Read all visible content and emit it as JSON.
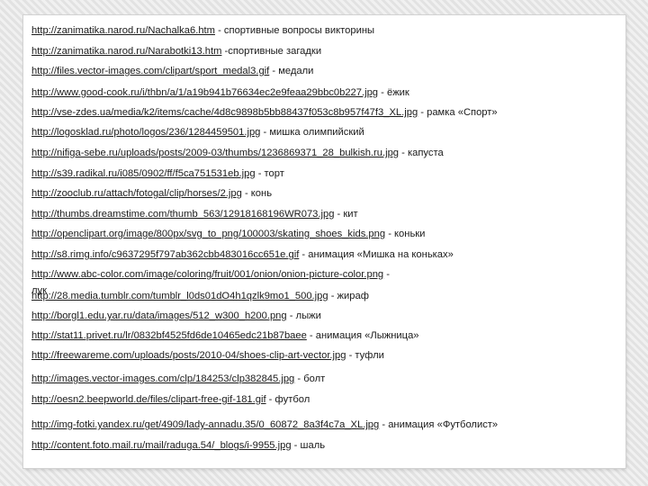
{
  "links": [
    {
      "url": "http://zanimatika.narod.ru/Nachalka6.htm",
      "desc": " - спортивные вопросы викторины"
    },
    {
      "url": "http://zanimatika.narod.ru/Narabotki13.htm",
      "desc": " -спортивные загадки"
    },
    {
      "url": "http://files.vector-images.com/clipart/sport_medal3.gif",
      "desc": " - медали"
    },
    {
      "url": "http://www.good-cook.ru/i/thbn/a/1/a19b941b76634ec2e9feaa29bbc0b227.jpg",
      "desc": " - ёжик"
    },
    {
      "url": "http://vse-zdes.ua/media/k2/items/cache/4d8c9898b5bb88437f053c8b957f47f3_XL.jpg",
      "desc": " - рамка «Спорт»"
    },
    {
      "url": "http://logosklad.ru/photo/logos/236/1284459501.jpg",
      "desc": " - мишка олимпийский"
    },
    {
      "url": "http://nifiga-sebe.ru/uploads/posts/2009-03/thumbs/1236869371_28_bulkish.ru.jpg",
      "desc": " - капуста"
    },
    {
      "url": "http://s39.radikal.ru/i085/0902/ff/f5ca751531eb.jpg",
      "desc": " - торт"
    },
    {
      "url": "http://zooclub.ru/attach/fotogal/clip/horses/2.jpg",
      "desc": " - конь"
    },
    {
      "url": "http://thumbs.dreamstime.com/thumb_563/12918168196WR073.jpg",
      "desc": " - кит"
    },
    {
      "url": "http://openclipart.org/image/800px/svg_to_png/100003/skating_shoes_kids.png",
      "desc": " - коньки"
    },
    {
      "url": "http://s8.rimg.info/c9637295f797ab362cbb483016cc651e.gif",
      "desc": " - анимация «Мишка на коньках»"
    },
    {
      "url": "http://www.abc-color.com/image/coloring/fruit/001/onion/onion-picture-color.png",
      "desc": " -"
    },
    {
      "url": "http://28.media.tumblr.com/tumblr_l0ds01dO4h1qzlk9mo1_500.jpg",
      "desc": " - жираф"
    },
    {
      "url": "http://borgl1.edu.yar.ru/data/images/512_w300_h200.png",
      "desc": " - лыжи"
    },
    {
      "url": "http://stat11.privet.ru/lr/0832bf4525fd6de10465edc21b87baee",
      "desc": " - анимация «Лыжница»"
    },
    {
      "url": "http://freewareme.com/uploads/posts/2010-04/shoes-clip-art-vector.jpg",
      "desc": " - туфли"
    },
    {
      "url": "http://images.vector-images.com/clp/184253/clp382845.jpg",
      "desc": " - болт"
    },
    {
      "url": "http://oesn2.beepworld.de/files/clipart-free-gif-181.gif",
      "desc": " - футбол"
    },
    {
      "url": "http://img-fotki.yandex.ru/get/4909/lady-annadu.35/0_60872_8a3f4c7a_XL.jpg",
      "desc": " - анимация «Футболист»"
    },
    {
      "url": "http://content.foto.mail.ru/mail/raduga.54/_blogs/i-9955.jpg",
      "desc": " - шаль"
    }
  ],
  "overflow_text": "лук"
}
